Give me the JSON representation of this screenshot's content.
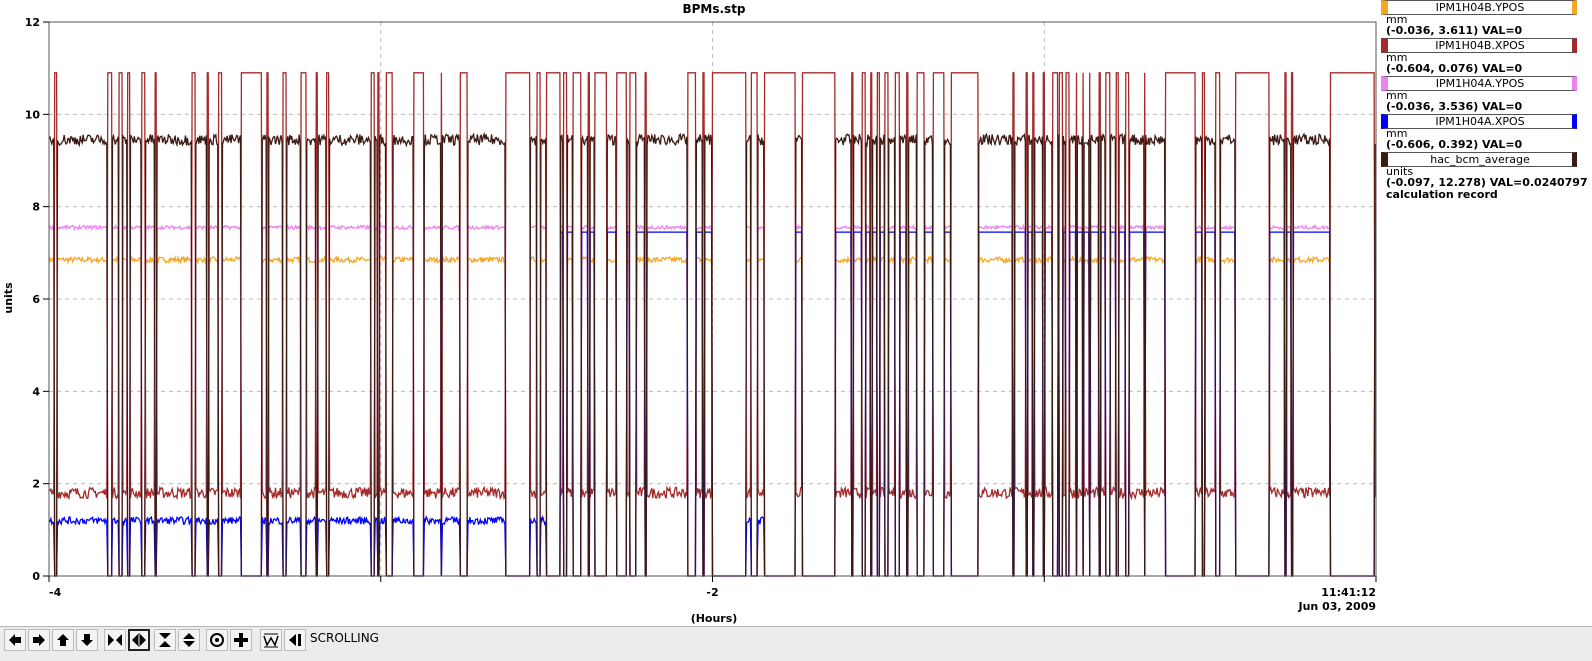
{
  "window_title": "BPMs.stp",
  "chart_data": {
    "type": "line",
    "title": "BPMs.stp",
    "xlabel": "(Hours)",
    "ylabel": "units",
    "xlim": [
      -4,
      0
    ],
    "ylim": [
      0,
      12
    ],
    "x_ticks": [
      -4,
      -3,
      -2,
      -1,
      0
    ],
    "x_tick_labels": [
      "-4",
      "",
      "-2",
      "",
      "11:41:12"
    ],
    "x_end_date": "Jun 03, 2009",
    "y_ticks": [
      0,
      2,
      4,
      6,
      8,
      10,
      12
    ],
    "y_tick_labels": [
      "0",
      "2",
      "4",
      "6",
      "8",
      "10",
      "12"
    ],
    "grid": true,
    "legend_position": "right",
    "beam_off_intervals": [
      [
        -3.985,
        -3.975
      ],
      [
        -3.825,
        -3.81
      ],
      [
        -3.79,
        -3.78
      ],
      [
        -3.765,
        -3.755
      ],
      [
        -3.72,
        -3.71
      ],
      [
        -3.68,
        -3.675
      ],
      [
        -3.57,
        -3.56
      ],
      [
        -3.525,
        -3.52
      ],
      [
        -3.49,
        -3.48
      ],
      [
        -3.42,
        -3.36
      ],
      [
        -3.345,
        -3.34
      ],
      [
        -3.295,
        -3.285
      ],
      [
        -3.24,
        -3.225
      ],
      [
        -3.195,
        -3.19
      ],
      [
        -3.165,
        -3.155
      ],
      [
        -3.03,
        -3.02
      ],
      [
        -3.01,
        -3.005
      ],
      [
        -2.985,
        -2.965
      ],
      [
        -2.9,
        -2.87
      ],
      [
        -2.82,
        -2.815
      ],
      [
        -2.76,
        -2.74
      ],
      [
        -2.62,
        -2.62
      ],
      [
        -2.625,
        -2.55
      ],
      [
        -2.53,
        -2.52
      ],
      [
        -2.5,
        -2.46
      ],
      [
        -2.45,
        -2.44
      ],
      [
        -2.42,
        -2.395
      ],
      [
        -2.375,
        -2.37
      ],
      [
        -2.355,
        -2.32
      ],
      [
        -2.29,
        -2.26
      ],
      [
        -2.25,
        -2.23
      ],
      [
        -2.205,
        -2.2
      ],
      [
        -2.075,
        -2.05
      ],
      [
        -2.03,
        -2.025
      ],
      [
        -2.0,
        -1.9
      ],
      [
        -1.885,
        -1.865
      ],
      [
        -1.845,
        -1.75
      ],
      [
        -1.73,
        -1.63
      ],
      [
        -1.58,
        -1.575
      ],
      [
        -1.55,
        -1.54
      ],
      [
        -1.525,
        -1.52
      ],
      [
        -1.505,
        -1.495
      ],
      [
        -1.48,
        -1.47
      ],
      [
        -1.45,
        -1.435
      ],
      [
        -1.415,
        -1.41
      ],
      [
        -1.385,
        -1.36
      ],
      [
        -1.335,
        -1.3
      ],
      [
        -1.28,
        -1.2
      ],
      [
        -1.095,
        -1.09
      ],
      [
        -1.055,
        -1.05
      ],
      [
        -1.035,
        -1.03
      ],
      [
        -1.005,
        -1.0
      ],
      [
        -0.975,
        -0.96
      ],
      [
        -0.955,
        -0.945
      ],
      [
        -0.935,
        -0.925
      ],
      [
        -0.905,
        -0.9
      ],
      [
        -0.885,
        -0.88
      ],
      [
        -0.865,
        -0.86
      ],
      [
        -0.835,
        -0.83
      ],
      [
        -0.815,
        -0.8
      ],
      [
        -0.785,
        -0.775
      ],
      [
        -0.755,
        -0.745
      ],
      [
        -0.7,
        -0.695
      ],
      [
        -0.635,
        -0.545
      ],
      [
        -0.525,
        -0.515
      ],
      [
        -0.485,
        -0.47
      ],
      [
        -0.425,
        -0.32
      ],
      [
        -0.275,
        -0.27
      ],
      [
        -0.255,
        -0.25
      ],
      [
        -0.14,
        -0.005
      ]
    ],
    "series": [
      {
        "name": "IPM1H04B.YPOS",
        "color": "#f5a623",
        "baseline": 6.85,
        "noise": 0.06,
        "beam_off_value": 0.0
      },
      {
        "name": "IPM1H04B.XPOS",
        "color": "#a52a2a",
        "baseline": 1.8,
        "noise": 0.12,
        "beam_off_value": 10.9
      },
      {
        "name": "IPM1H04A.YPOS",
        "color": "#ee82ee",
        "baseline": 7.55,
        "noise": 0.04,
        "beam_off_value": 0.0
      },
      {
        "name": "IPM1H04A.XPOS",
        "color": "#0000ff",
        "baseline": 1.2,
        "noise": 0.08,
        "beam_off_value": 0.0,
        "flat_segments": [
          [
            -2.48,
            -2.0,
            7.45
          ],
          [
            -1.83,
            0,
            7.45
          ]
        ]
      },
      {
        "name": "hac_bcm_average",
        "color": "#3b1a12",
        "baseline": 9.45,
        "noise": 0.12,
        "beam_off_value": 0.0
      }
    ]
  },
  "legend": [
    {
      "name": "IPM1H04B.YPOS",
      "color": "#f5a623",
      "unit": "mm",
      "info": "(-0.036, 3.611) VAL=0"
    },
    {
      "name": "IPM1H04B.XPOS",
      "color": "#a52a2a",
      "unit": "mm",
      "info": "(-0.604, 0.076) VAL=0"
    },
    {
      "name": "IPM1H04A.YPOS",
      "color": "#ee82ee",
      "unit": "mm",
      "info": "(-0.036, 3.536) VAL=0"
    },
    {
      "name": "IPM1H04A.XPOS",
      "color": "#0000ff",
      "unit": "mm",
      "info": "(-0.606, 0.392) VAL=0"
    },
    {
      "name": "hac_bcm_average",
      "color": "#3b1a12",
      "unit": "units",
      "info": "(-0.097, 12.278) VAL=0.0240797",
      "extra": "calculation record"
    }
  ],
  "toolbar": {
    "status": "SCROLLING",
    "buttons": [
      {
        "icon": "arrow-left-icon"
      },
      {
        "icon": "arrow-right-icon"
      },
      {
        "icon": "arrow-up-icon"
      },
      {
        "icon": "arrow-down-icon"
      },
      {
        "icon": "zoom-in-x-icon"
      },
      {
        "icon": "zoom-out-x-icon"
      },
      {
        "icon": "zoom-in-y-icon"
      },
      {
        "icon": "zoom-out-y-icon"
      },
      {
        "icon": "circle-icon"
      },
      {
        "icon": "plus-icon"
      },
      {
        "icon": "autoscale-icon"
      },
      {
        "icon": "scroll-back-icon"
      }
    ]
  }
}
